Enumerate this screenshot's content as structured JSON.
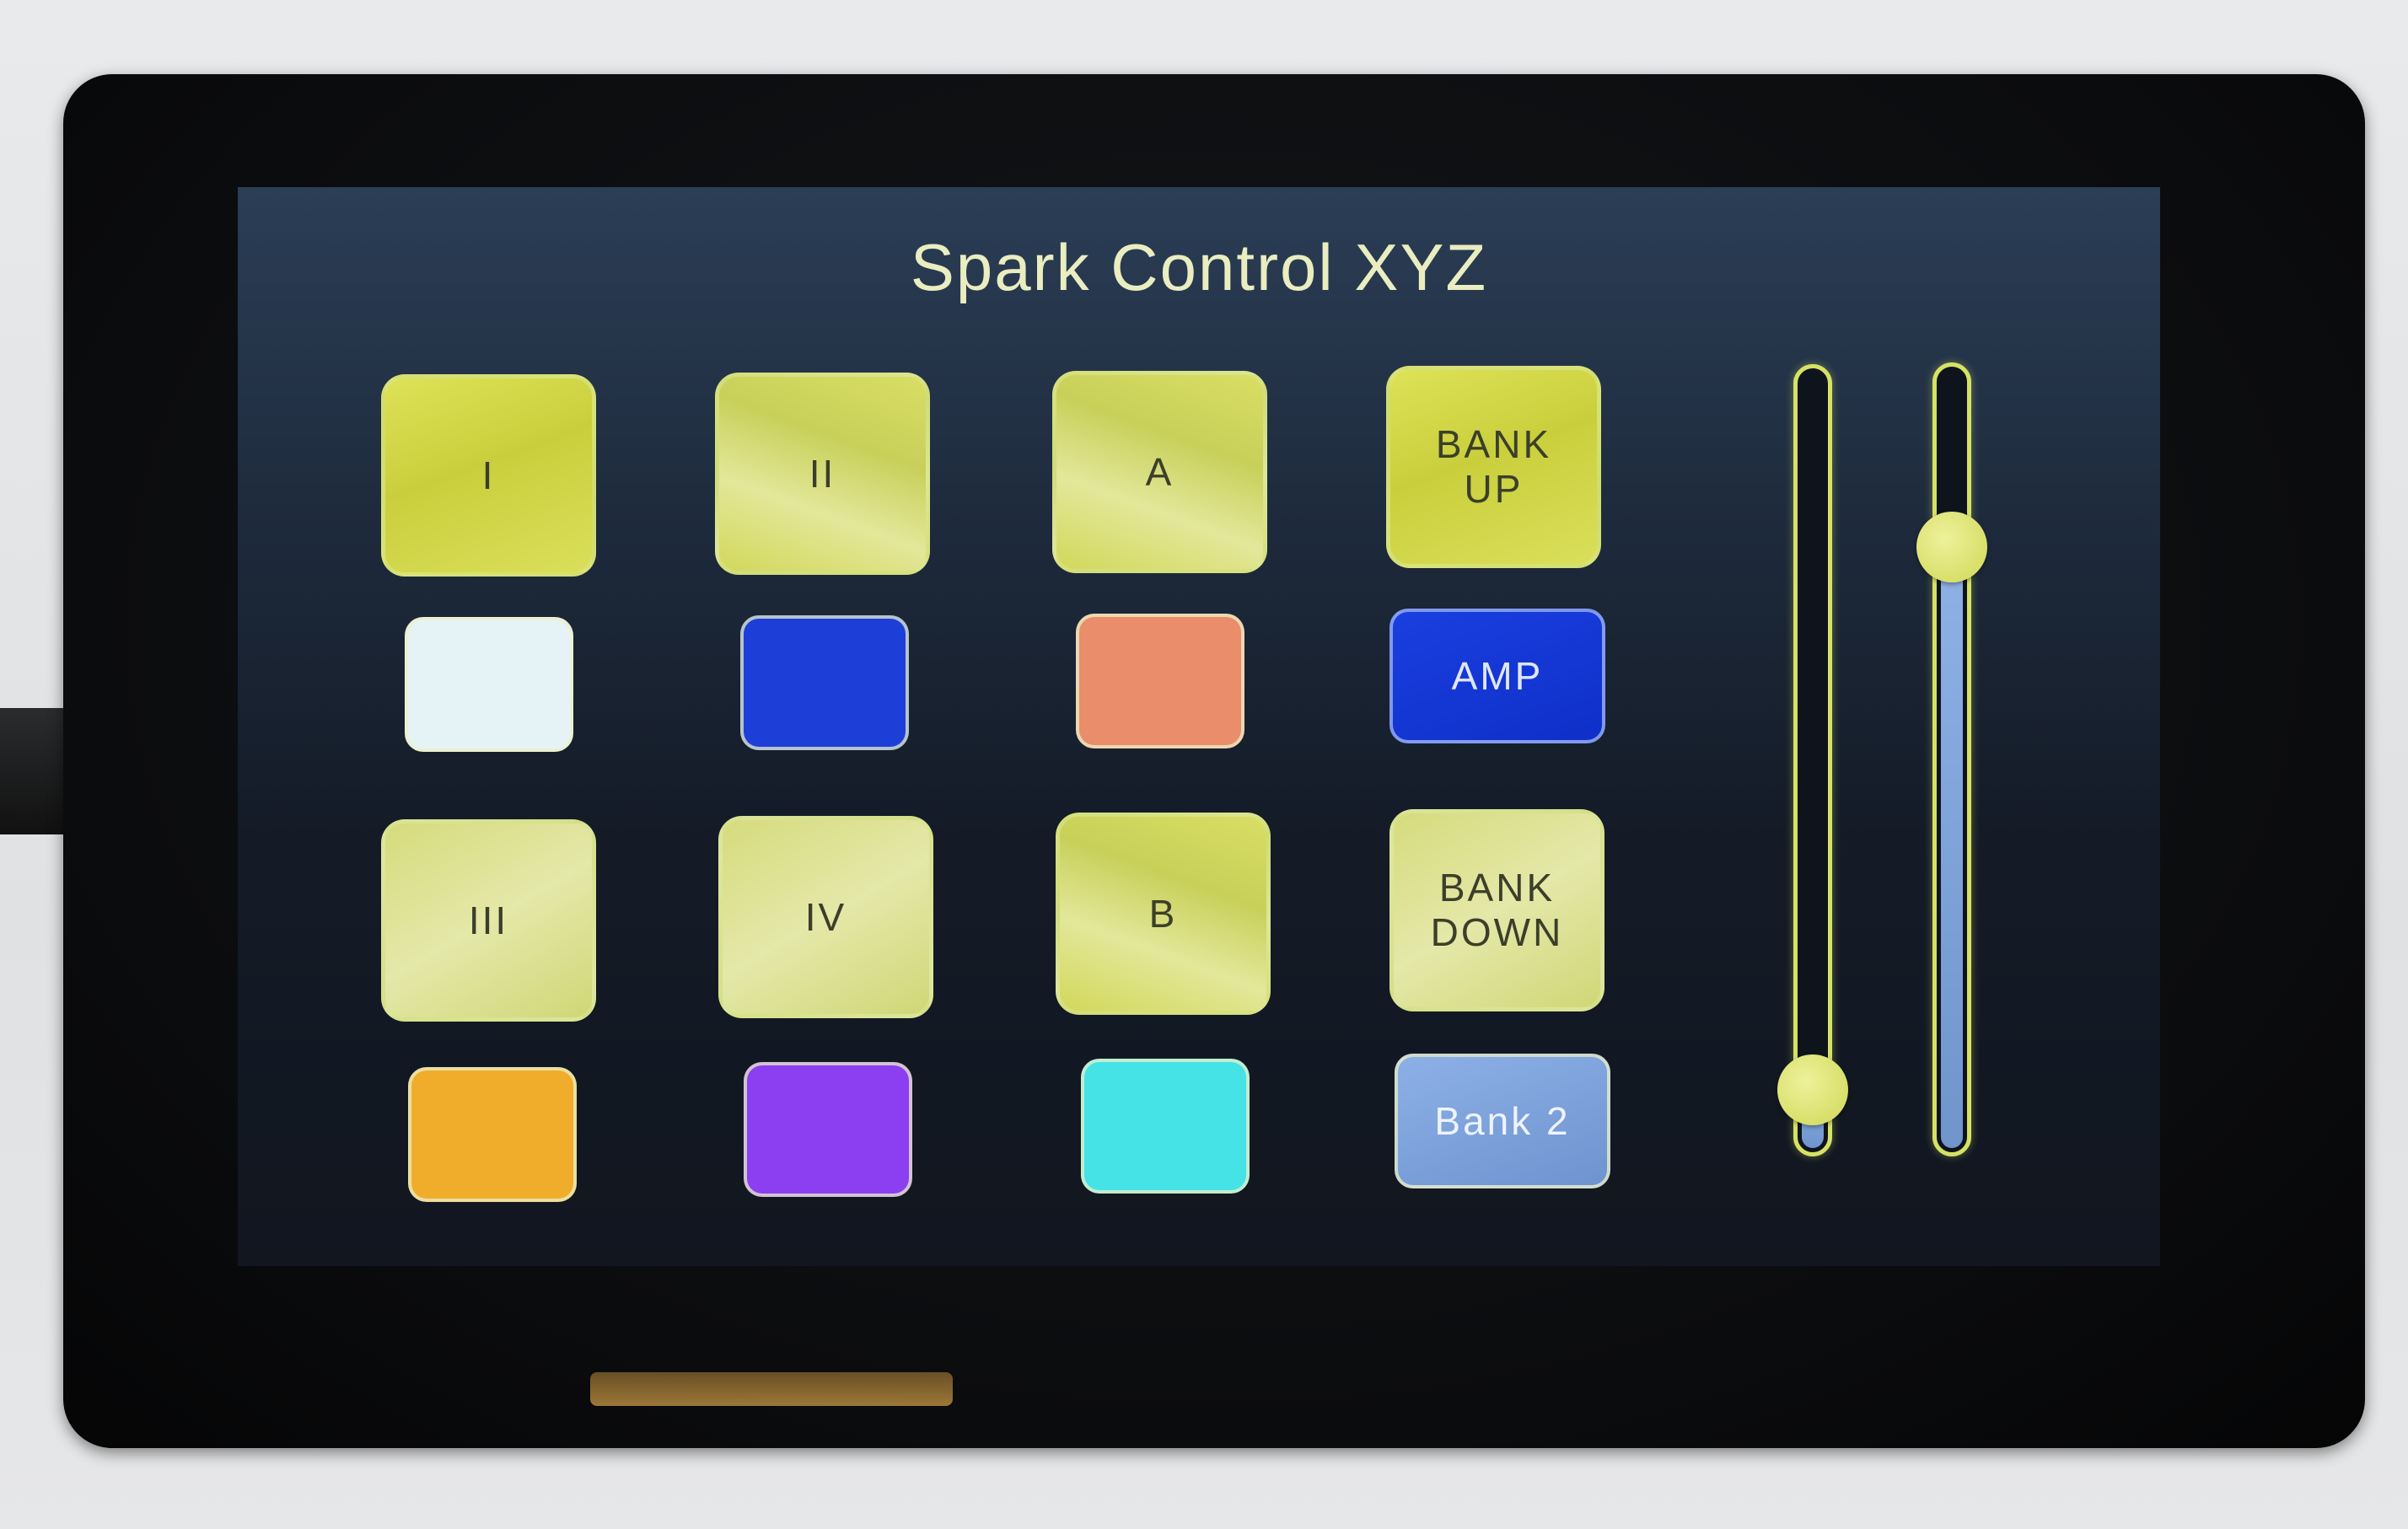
{
  "app": {
    "title": "Spark Control XYZ"
  },
  "presets": [
    {
      "label": "I"
    },
    {
      "label": "II"
    },
    {
      "label": "III"
    },
    {
      "label": "IV"
    }
  ],
  "modes": [
    {
      "label": "A"
    },
    {
      "label": "B"
    }
  ],
  "bank": {
    "up_label": "BANK\nUP",
    "down_label": "BANK\nDOWN",
    "amp_label": "AMP",
    "current_label": "Bank 2"
  },
  "color_swatches": [
    {
      "name": "white",
      "color": "#e6f3f6"
    },
    {
      "name": "blue",
      "color": "#1d3fd8"
    },
    {
      "name": "salmon",
      "color": "#e98d6b"
    },
    {
      "name": "orange",
      "color": "#f0ad2c"
    },
    {
      "name": "purple",
      "color": "#8b3ff0"
    },
    {
      "name": "cyan",
      "color": "#45e2e6"
    }
  ],
  "colors": {
    "accent": "#d6e264",
    "amp_button": "#1338d6",
    "bank_indicator": "#7ea4dc"
  },
  "sliders": [
    {
      "name": "slider-1",
      "level": 0.08
    },
    {
      "name": "slider-2",
      "level": 0.77
    }
  ]
}
